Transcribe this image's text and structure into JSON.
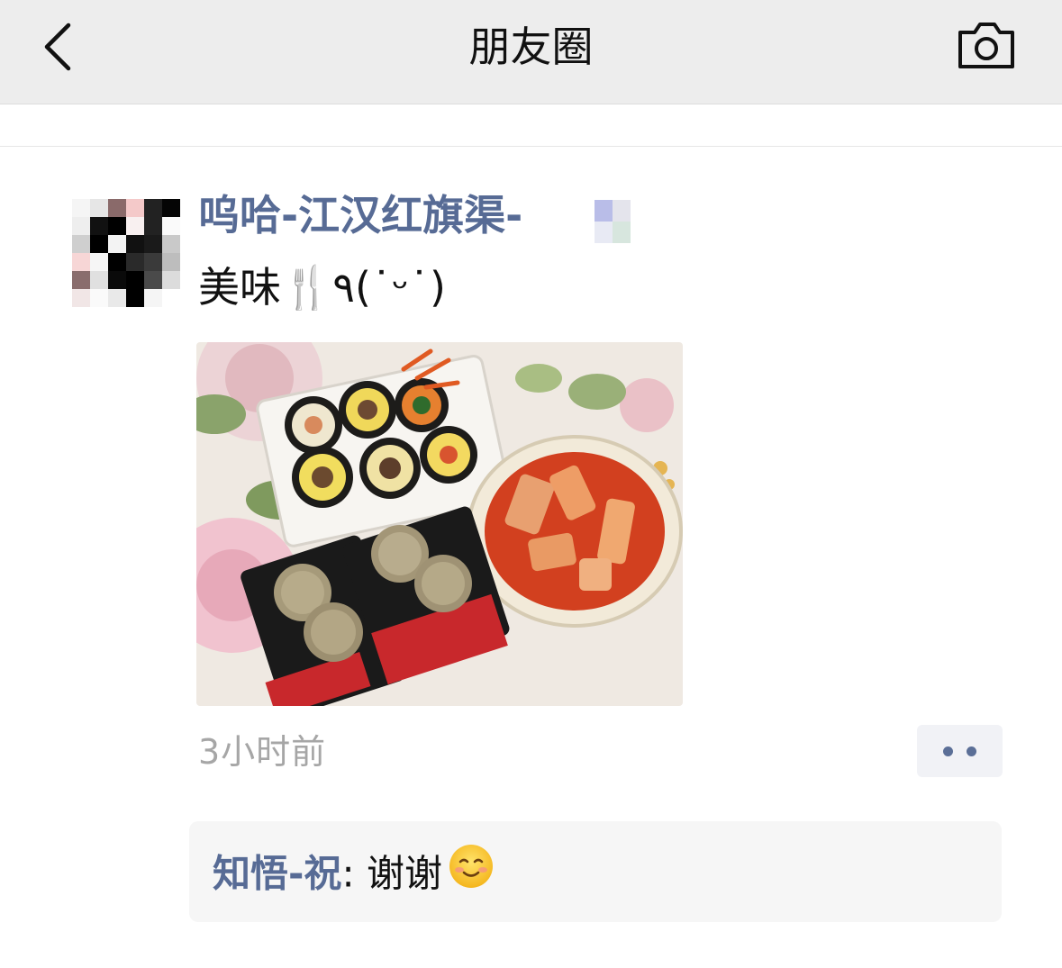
{
  "nav": {
    "title": "朋友圈",
    "back_icon": "chevron-left-icon",
    "camera_icon": "camera-icon"
  },
  "post": {
    "author": "呜哈-江汉红旗渠-",
    "text": "美味🍴٩(˙ᵕ˙)",
    "time": "3小时前",
    "more_icon": "more-dots-icon"
  },
  "comments": [
    {
      "author": "知悟-祝",
      "separator": ": ",
      "text": "谢谢",
      "emoji_icon": "smiling-face-icon"
    }
  ],
  "colors": {
    "link": "#576b95",
    "navbar_bg": "#ededed",
    "comment_bg": "#f6f6f6",
    "timestamp": "#a6a6a6"
  }
}
